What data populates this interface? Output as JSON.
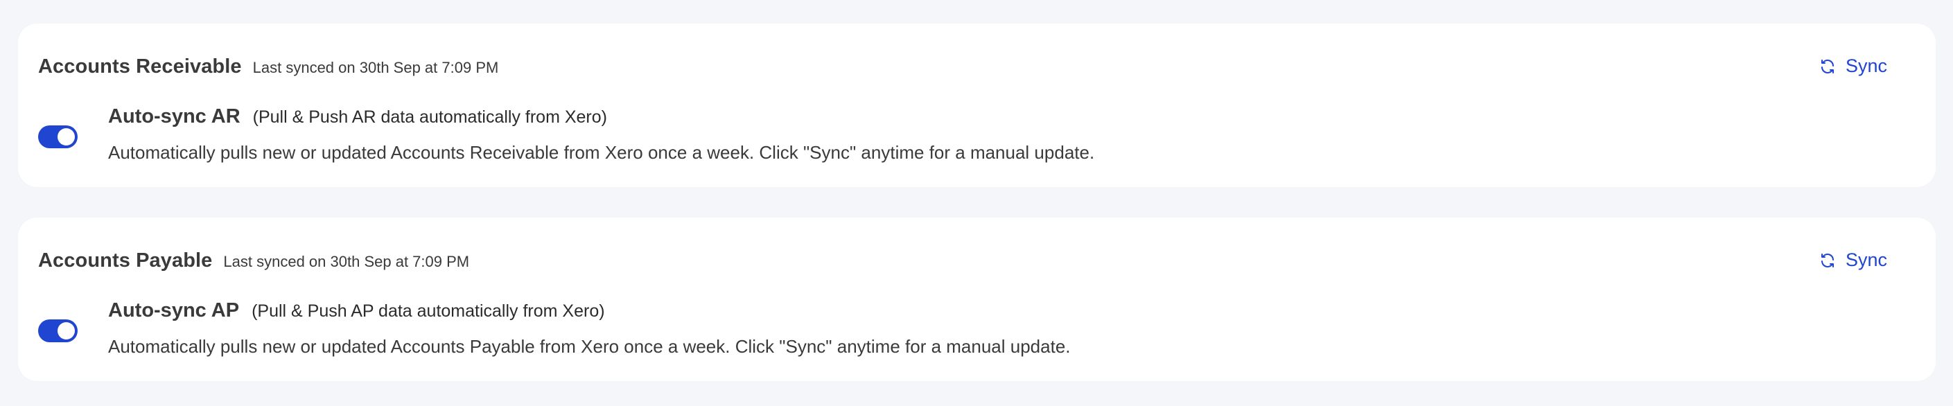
{
  "colors": {
    "accent": "#1f45d1",
    "background": "#f5f6fa",
    "card": "#ffffff",
    "text": "#3a3a3a"
  },
  "sections": {
    "ar": {
      "title": "Accounts Receivable",
      "last_synced": "Last synced on 30th Sep at 7:09 PM",
      "sync_label": "Sync",
      "sync_icon": "refresh-icon",
      "toggle_on": true,
      "setting_title": "Auto-sync AR",
      "setting_note": "(Pull & Push AR data automatically from Xero)",
      "setting_desc": "Automatically pulls new or updated Accounts Receivable from Xero once a week. Click \"Sync\" anytime for a manual update."
    },
    "ap": {
      "title": "Accounts Payable",
      "last_synced": "Last synced on 30th Sep at 7:09 PM",
      "sync_label": "Sync",
      "sync_icon": "refresh-icon",
      "toggle_on": true,
      "setting_title": "Auto-sync AP",
      "setting_note": "(Pull & Push AP data automatically from Xero)",
      "setting_desc": "Automatically pulls new or updated Accounts Payable from Xero once a week. Click \"Sync\" anytime for a manual update."
    }
  }
}
